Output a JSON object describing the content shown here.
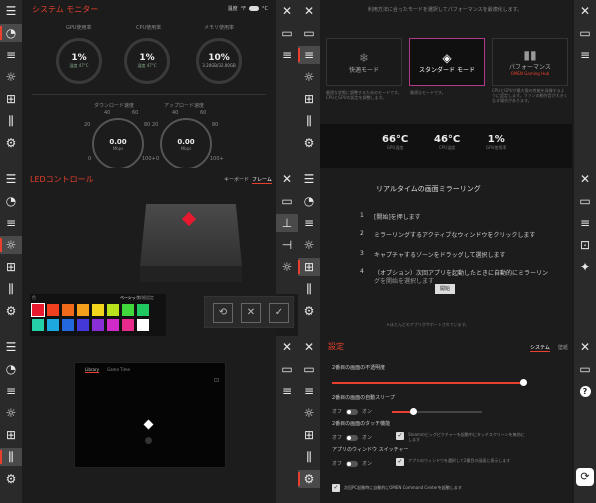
{
  "colors": {
    "accent": "#e8402c",
    "sidebar": "#2a2a2a",
    "panel": "#1c1c1c",
    "select": "#b03a8a"
  },
  "icons": {
    "close": "close-icon",
    "window": "window-icon",
    "gauge": "gauge-icon",
    "list": "list-icon",
    "light": "light-icon",
    "grid": "grid-icon",
    "library": "library-icon",
    "gear": "gear-icon",
    "help": "help-icon"
  },
  "sysmon": {
    "title": "システム モニター",
    "temp_label": "温度",
    "temp_f": "°F",
    "temp_c": "°C",
    "gauges": [
      {
        "label": "GPU使用率",
        "value": "1%",
        "sub1": "温度",
        "sub2": "47°C"
      },
      {
        "label": "CPU使用率",
        "value": "1%",
        "sub1": "温度",
        "sub2": "47°C"
      },
      {
        "label": "メモリ使用率",
        "value": "10%",
        "sub1": "3.20GB/32.00GB",
        "sub2": ""
      }
    ],
    "net": [
      {
        "label": "ダウンロード速度",
        "value": "0.00",
        "unit": "Mbps",
        "ticks": [
          "0",
          "20",
          "40",
          "60",
          "80",
          "100+"
        ]
      },
      {
        "label": "アップロード速度",
        "value": "0.00",
        "unit": "Mbps",
        "ticks": [
          "0",
          "20",
          "40",
          "60",
          "80",
          "100+"
        ]
      }
    ]
  },
  "perf": {
    "header": "利用方法に合ったモードを選択してパフォーマンスを最適化します。",
    "modes": [
      {
        "label": "快適モード"
      },
      {
        "label": "スタンダード モード"
      },
      {
        "label": "パフォーマンス",
        "sub": "OMEN Gaming Hub"
      }
    ],
    "desc_left": "最適な状態に調整するためのモードです。CPUとGPUの設定を調整します。",
    "desc_mid": "最適なモードです。",
    "desc_right": "CPUとGPUが最大限の性能を発揮するように設定します。ファンの動作音が大きくなる場合があります。",
    "stats": [
      {
        "value": "66°C",
        "label": "GPU温度"
      },
      {
        "value": "46°C",
        "label": "CPU温度"
      },
      {
        "value": "1%",
        "label": "GPU使用率"
      }
    ]
  },
  "led": {
    "title": "LEDコントロール",
    "tabs": [
      "キーボード",
      "フレーム"
    ],
    "palette_label": "色",
    "palette_tabs": [
      "ベーシック",
      "詳細設定"
    ],
    "colors": [
      "#e6192e",
      "#f04020",
      "#f06a1a",
      "#f5a01c",
      "#f3d61c",
      "#b8e21c",
      "#40d83a",
      "#20c860",
      "#25d0a8",
      "#1ea8e0",
      "#2468e0",
      "#4438d8",
      "#8a2ed8",
      "#d02ac8",
      "#e82a8a",
      "#ffffff"
    ]
  },
  "mirror": {
    "title": "リアルタイムの画面ミラーリング",
    "steps": [
      {
        "num": "1",
        "text": "[開始]を押します"
      },
      {
        "num": "2",
        "text": "ミラーリングするアクティブなウィンドウをクリックします"
      },
      {
        "num": "3",
        "text": "キャプチャするゾーンをドラッグして選択します"
      },
      {
        "num": "4",
        "text": "（オプション）次回アプリを起動したときに自動的にミラーリン"
      }
    ],
    "step4_cont": "グを開始を選択します",
    "start_button": "開始",
    "footnote": "＊ほとんどのアプリがサポートされています。"
  },
  "capture": {
    "tabs": [
      "Library",
      "Game Time"
    ]
  },
  "settings": {
    "title": "設定",
    "tabs": [
      "システム",
      "壁紙"
    ],
    "opacity_label": "2番目の画面の不透明度",
    "sleep_label": "2番目の画面の自動スリープ",
    "sleep_toggle": "オン",
    "sleep_toggle_off": "オフ",
    "touch_label": "2番目の画面のタッチ機能",
    "touch_toggle": "オン",
    "touch_toggle_off": "オフ",
    "touch_note": "Steamのビッグピクチャーを起動中にタッチスクリーンを無効にします",
    "switch_label": "アプリのウィンドウ スイッチャー",
    "switch_toggle": "オン",
    "switch_toggle_off": "オフ",
    "switch_note": "アプリのウィンドウを選択して2番目の画面に表示します",
    "bottom_check": "次回PC起動時に自動的にOMEN Command Centerを起動します"
  }
}
